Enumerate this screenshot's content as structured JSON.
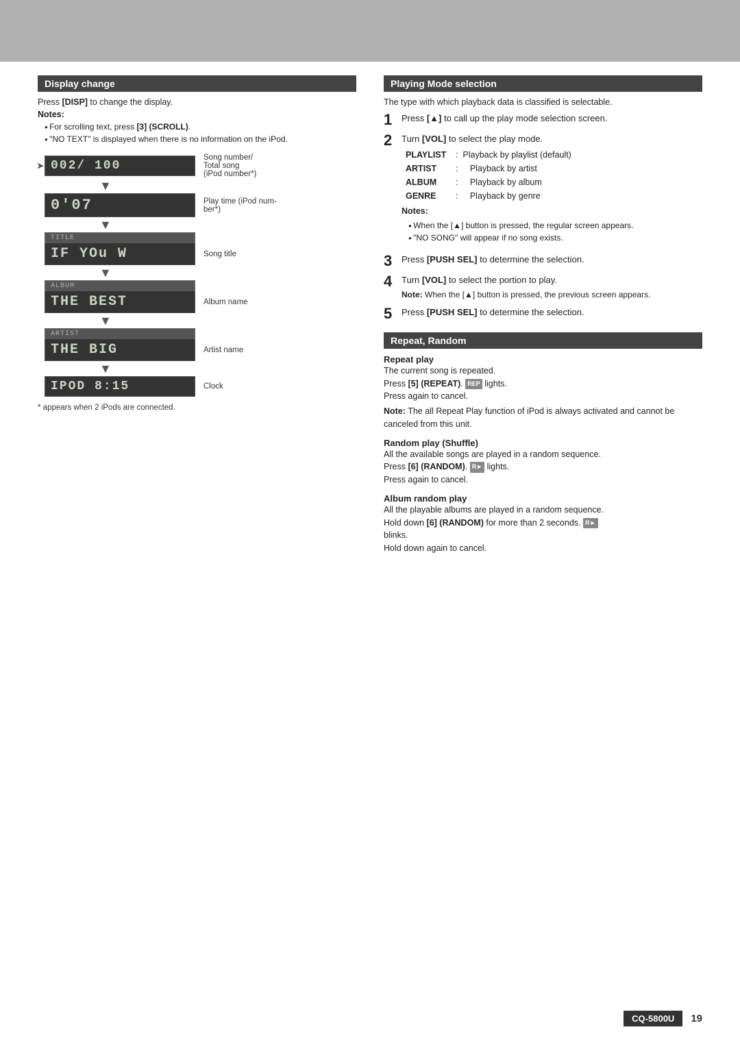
{
  "top_banner": {},
  "left": {
    "section_title": "Display change",
    "intro": "Press [DISP] to change the display.",
    "notes_label": "Notes:",
    "bullets": [
      "For scrolling text, press [3] (SCROLL).",
      "\"NO TEXT\" is displayed when there is no information on the iPod."
    ],
    "displays": [
      {
        "lcd_text": "002/ 100",
        "label_line1": "Song number/",
        "label_line2": "Total song",
        "label_line3": "(iPod number*)"
      },
      {
        "lcd_text": "0'07",
        "label_line1": "Play time (iPod num-",
        "label_line2": "ber*)"
      },
      {
        "lcd_top": "TITLE",
        "lcd_main": "IF YOU W",
        "label": "Song title"
      },
      {
        "lcd_top": "ALBUM",
        "lcd_main": "THE BEST",
        "label": "Album name"
      },
      {
        "lcd_top": "ARTIST",
        "lcd_main": "THE BIG",
        "label": "Artist name"
      },
      {
        "lcd_text": "IPOD 8:15",
        "label": "Clock"
      }
    ],
    "footnote": "* appears when 2 iPods are connected."
  },
  "right": {
    "playing_mode": {
      "section_title": "Playing Mode selection",
      "intro": "The type with which playback data is classified is selectable.",
      "steps": [
        {
          "number": "1",
          "text": "Press [▲] to call up the play mode selection screen."
        },
        {
          "number": "2",
          "text": "Turn [VOL] to select the play mode.",
          "table": [
            {
              "key": "PLAYLIST",
              "value": "Playback by playlist (default)"
            },
            {
              "key": "ARTIST",
              "value": "Playback by artist"
            },
            {
              "key": "ALBUM",
              "value": "Playback by album"
            },
            {
              "key": "GENRE",
              "value": "Playback by genre"
            }
          ],
          "notes_label": "Notes:",
          "notes": [
            "When the [▲] button is pressed, the regular screen appears.",
            "\"NO SONG\" will appear if no song exists."
          ]
        },
        {
          "number": "3",
          "text": "Press [PUSH SEL] to determine the selection."
        },
        {
          "number": "4",
          "text": "Turn [VOL] to select the portion to play.",
          "note": "Note: When the [▲] button is pressed, the previous screen appears."
        },
        {
          "number": "5",
          "text": "Press [PUSH SEL] to determine the selection."
        }
      ]
    },
    "repeat_random": {
      "section_title": "Repeat, Random",
      "repeat_play": {
        "title": "Repeat play",
        "body": "The current song is repeated.",
        "press": "Press [5] (REPEAT).",
        "badge": "REP",
        "badge_suffix": " lights.",
        "cancel": "Press again to cancel.",
        "note": "Note: The all Repeat Play function of iPod is always activated and cannot be canceled from this unit."
      },
      "random_play": {
        "title": "Random play (Shuffle)",
        "body": "All the available songs are played in a random sequence.",
        "press": "Press [6] (RANDOM).",
        "badge": "R►",
        "badge_suffix": " lights.",
        "cancel": "Press again to cancel."
      },
      "album_random": {
        "title": "Album random play",
        "body": "All the playable albums are played in a random sequence.",
        "press": "Hold down [6] (RANDOM) for more than 2 seconds.",
        "badge": "R►",
        "blinks": " blinks.",
        "cancel": "Hold down again to cancel."
      }
    }
  },
  "footer": {
    "model": "CQ-5800U",
    "page": "19"
  }
}
